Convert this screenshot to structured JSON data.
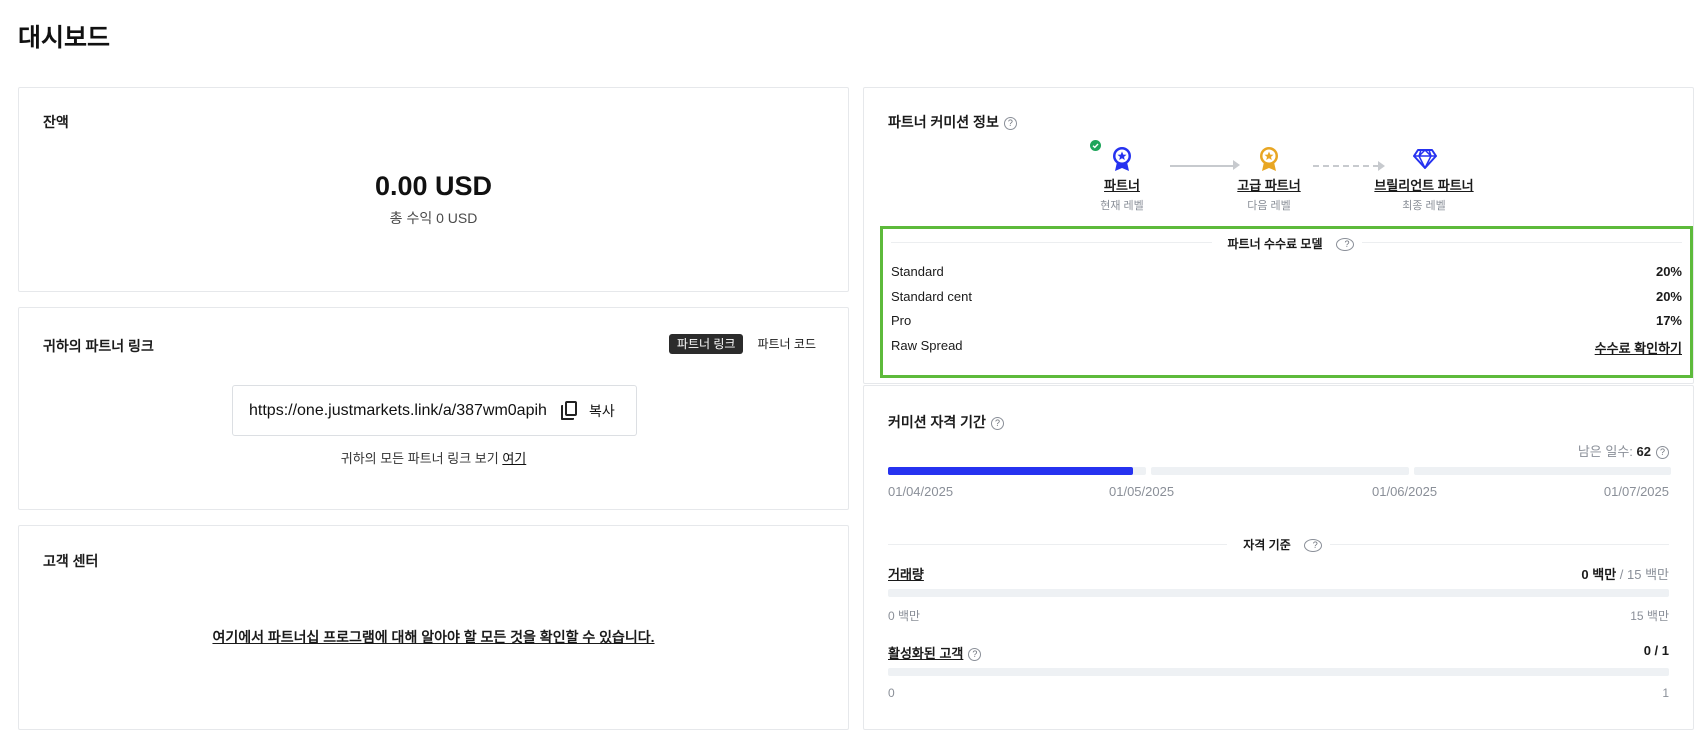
{
  "page": {
    "title": "대시보드"
  },
  "balance": {
    "title": "잔액",
    "amount": "0.00 USD",
    "total_earnings": "총 수익 0 USD"
  },
  "partner_link": {
    "title": "귀하의 파트너 링크",
    "toggle": {
      "link_label": "파트너 링크",
      "code_label": "파트너 코드",
      "active": "파트너 링크"
    },
    "url": "https://one.justmarkets.link/a/387wm0apih",
    "copy_label": "복사",
    "note_text": "귀하의 모든 파트너 링크 보기 ",
    "note_link": "여기"
  },
  "support": {
    "title": "고객 센터",
    "link_text": "여기에서 파트너십 프로그램에 대해 알아야 할 모든 것을 확인할 수 있습니다."
  },
  "commission": {
    "title": "파트너 커미션 정보",
    "help": "?",
    "levels": [
      {
        "name": "파트너",
        "sub": "현재 레벨",
        "icon": "medal-blue-icon",
        "color": "#2632f0",
        "current": true
      },
      {
        "name": "고급 파트너",
        "sub": "다음 레벨",
        "icon": "medal-gold-icon",
        "color": "#e8a623",
        "current": false
      },
      {
        "name": "브릴리언트 파트너",
        "sub": "최종 레벨",
        "icon": "diamond-icon",
        "color": "#2632f0",
        "current": false
      }
    ],
    "model": {
      "title": "파트너 수수료 모델",
      "rows": [
        {
          "name": "Standard",
          "value": "20%"
        },
        {
          "name": "Standard cent",
          "value": "20%"
        },
        {
          "name": "Pro",
          "value": "17%"
        },
        {
          "name": "Raw Spread",
          "value": "수수료 확인하기"
        }
      ]
    }
  },
  "period": {
    "title": "커미션 자격 기간",
    "days_left_label": "남은 일수:",
    "days_left_value": "62",
    "progress_fraction_of_first_segment": 0.95,
    "dates": [
      "01/04/2025",
      "01/05/2025",
      "01/06/2025",
      "01/07/2025"
    ],
    "criteria_title": "자격 기준",
    "criteria": [
      {
        "label": "거래량",
        "current": "0 백만",
        "target": "/ 15 백만",
        "min": "0 백만",
        "max": "15 백만",
        "progress": 0
      },
      {
        "label": "활성화된 고객",
        "current": "0 / 1",
        "target": "",
        "min": "0",
        "max": "1",
        "progress": 0
      }
    ],
    "colors": {
      "accent": "#2632f0",
      "track": "#eef1f4"
    }
  }
}
